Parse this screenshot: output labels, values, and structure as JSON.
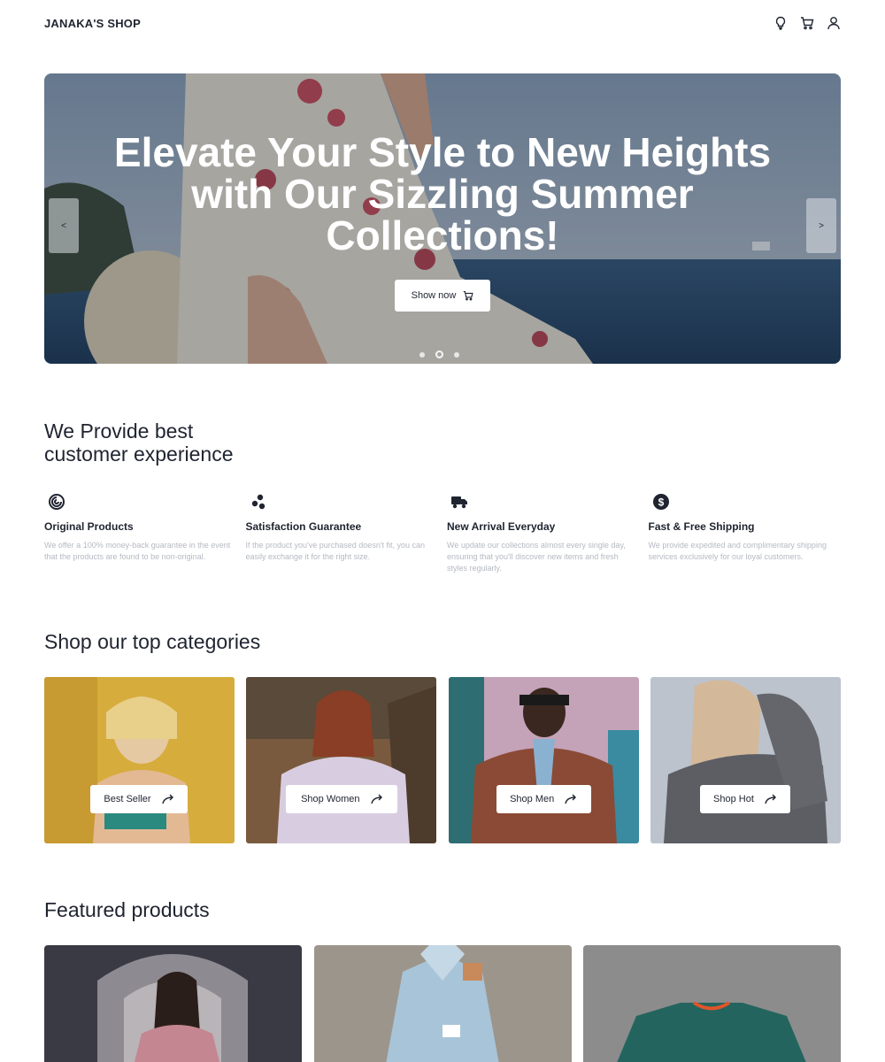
{
  "header": {
    "logo": "JANAKA'S SHOP",
    "icons": [
      "lightbulb-icon",
      "cart-icon",
      "user-icon"
    ]
  },
  "hero": {
    "title": "Elevate Your Style to New Heights with Our Sizzling Summer Collections!",
    "button_label": "Show now",
    "prev_label": "<",
    "next_label": ">",
    "slides": 3,
    "active_slide": 2
  },
  "experience": {
    "title_line1": "We Provide best",
    "title_line2": "customer experience",
    "features": [
      {
        "icon": "spiral-icon",
        "title": "Original Products",
        "desc": "We offer a 100% money-back guarantee in the event that the products are found to be non-original."
      },
      {
        "icon": "dots-icon",
        "title": "Satisfaction Guarantee",
        "desc": "If the product you've purchased doesn't fit, you can easily exchange it for the right size."
      },
      {
        "icon": "truck-icon",
        "title": "New Arrival Everyday",
        "desc": "We update our collections almost every single day, ensuring that you'll discover new items and fresh styles regularly."
      },
      {
        "icon": "dollar-icon",
        "title": "Fast & Free Shipping",
        "desc": "We provide expedited and complimentary shipping services exclusively for our loyal customers."
      }
    ]
  },
  "categories": {
    "title": "Shop our top categories",
    "items": [
      {
        "label": "Best Seller"
      },
      {
        "label": "Shop Women"
      },
      {
        "label": "Shop Men"
      },
      {
        "label": "Shop Hot"
      }
    ]
  },
  "featured": {
    "title": "Featured products"
  },
  "colors": {
    "text": "#1f2430",
    "muted": "#b5b9c2",
    "hero_sea": "#2e4a66"
  }
}
